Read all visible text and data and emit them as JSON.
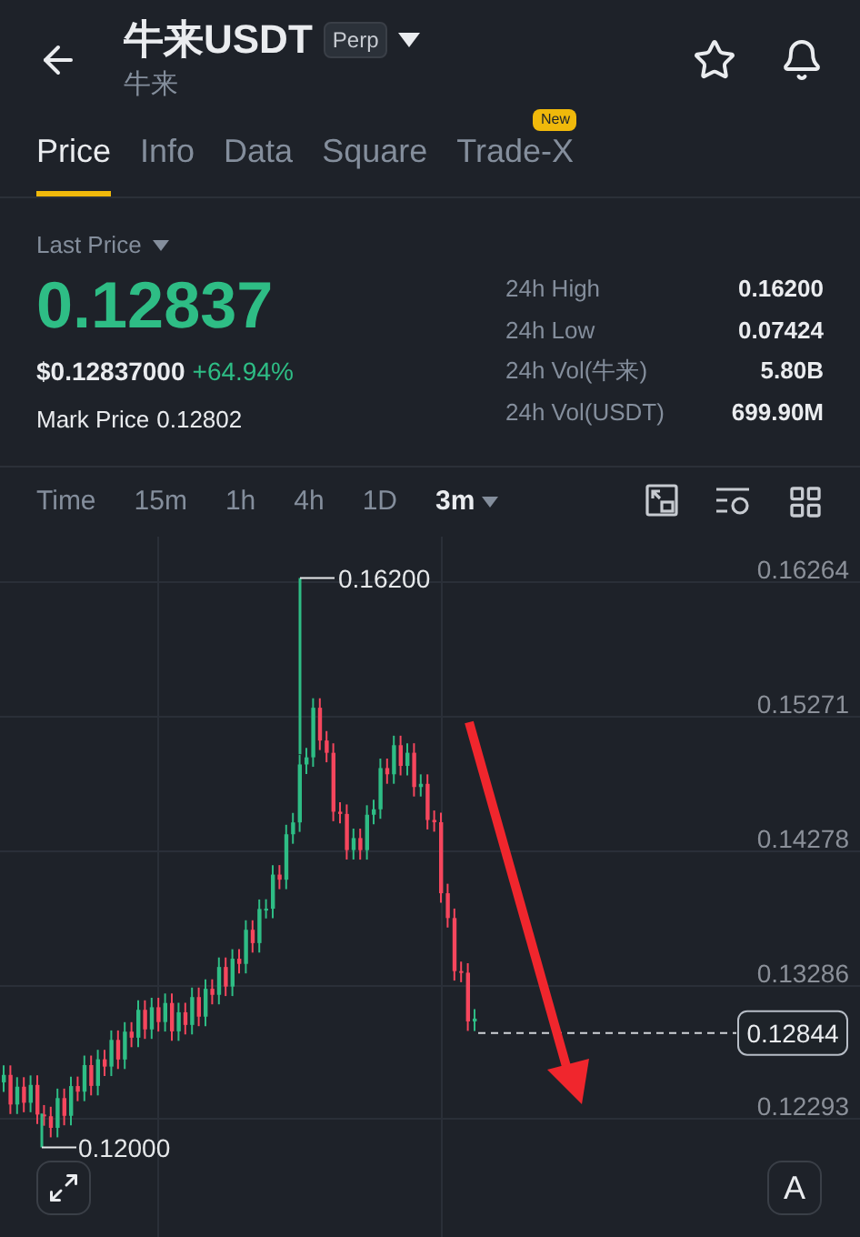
{
  "header": {
    "title": "牛来USDT",
    "badge": "Perp",
    "subtitle": "牛来"
  },
  "tabs": [
    {
      "label": "Price",
      "selected": true
    },
    {
      "label": "Info",
      "selected": false
    },
    {
      "label": "Data",
      "selected": false
    },
    {
      "label": "Square",
      "selected": false
    },
    {
      "label": "Trade-X",
      "selected": false,
      "badge": "New"
    }
  ],
  "price": {
    "label": "Last Price",
    "value": "0.12837",
    "usd_value": "$0.12837000",
    "change": "+64.94%",
    "mark_label": "Mark Price",
    "mark_value": "0.12802"
  },
  "stats": [
    {
      "label": "24h High",
      "value": "0.16200"
    },
    {
      "label": "24h Low",
      "value": "0.07424"
    },
    {
      "label": "24h Vol(牛来)",
      "value": "5.80B"
    },
    {
      "label": "24h Vol(USDT)",
      "value": "699.90M"
    }
  ],
  "intervals": [
    {
      "label": "Time",
      "selected": false
    },
    {
      "label": "15m",
      "selected": false
    },
    {
      "label": "1h",
      "selected": false
    },
    {
      "label": "4h",
      "selected": false
    },
    {
      "label": "1D",
      "selected": false
    },
    {
      "label": "3m",
      "selected": true,
      "dropdown": true
    }
  ],
  "chart": {
    "y_labels": [
      "0.16264",
      "0.15271",
      "0.14278",
      "0.13286",
      "0.12293"
    ],
    "high_marker": "0.16200",
    "low_marker": "0.12000",
    "current_price": "0.12844",
    "scale_button": "A"
  }
}
